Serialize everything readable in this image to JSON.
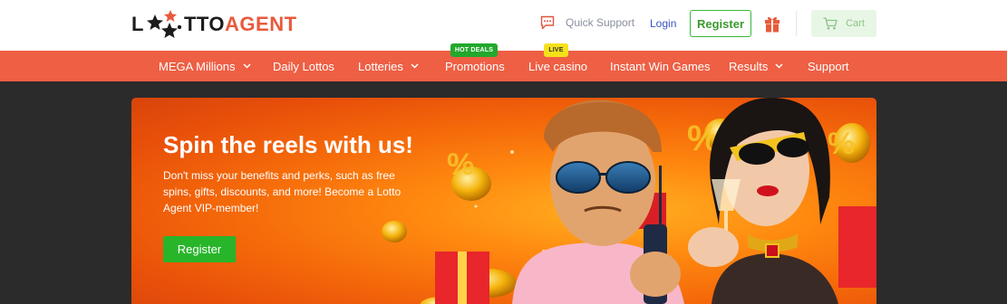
{
  "header": {
    "logo": {
      "l": "L",
      "tto": "TTO",
      "agent": "AGENT"
    },
    "support_label": "Quick Support",
    "login_label": "Login",
    "register_label": "Register",
    "cart_label": "Cart",
    "icons": [
      "chat-support-icon",
      "gift-icon",
      "cart-icon"
    ]
  },
  "nav": {
    "items": [
      {
        "label": "MEGA Millions",
        "has_dropdown": true
      },
      {
        "label": "Daily Lottos",
        "has_dropdown": false
      },
      {
        "label": "Lotteries",
        "has_dropdown": true
      },
      {
        "label": "Promotions",
        "has_dropdown": false,
        "badge": "HOT DEALS"
      },
      {
        "label": "Live casino",
        "has_dropdown": false,
        "badge": "LIVE"
      },
      {
        "label": "Instant Win Games",
        "has_dropdown": false
      },
      {
        "label": "Results",
        "has_dropdown": true
      },
      {
        "label": "Support",
        "has_dropdown": false
      }
    ]
  },
  "banner": {
    "title": "Spin the reels with us!",
    "text": "Don't miss your benefits and perks, such as free spins, gifts, discounts, and more! Become a Lotto Agent VIP-member!",
    "register_label": "Register"
  },
  "colors": {
    "brand_orange": "#ee5f44",
    "accent_green": "#28b52a",
    "link_blue": "#3a55c4",
    "page_background": "#2b2b2b"
  }
}
